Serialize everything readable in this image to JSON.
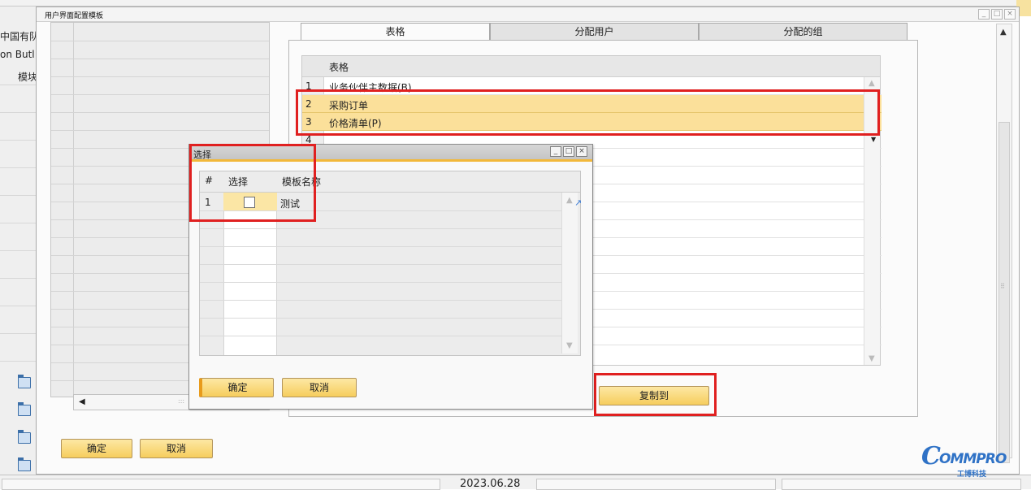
{
  "background": {
    "left_text_1": "中国有队",
    "left_text_2": "on Butl",
    "left_text_3": "模块",
    "status_date": "2023.06.28"
  },
  "window": {
    "title": "用户界面配置模板",
    "minimize": "_",
    "maximize": "□",
    "close": "×"
  },
  "tabs": [
    {
      "label": "表格",
      "active": true
    },
    {
      "label": "分配用户",
      "active": false
    },
    {
      "label": "分配的组",
      "active": false
    }
  ],
  "forms_table": {
    "header": "表格",
    "rows": [
      {
        "num": "1",
        "name": "业务伙伴主数据(B)"
      },
      {
        "num": "2",
        "name": "采购订单"
      },
      {
        "num": "3",
        "name": "价格清单(P)"
      },
      {
        "num": "4",
        "name": ""
      }
    ]
  },
  "copy_to_button": "复制到",
  "bottom_buttons": {
    "ok": "确定",
    "cancel": "取消"
  },
  "popup": {
    "title": "选择",
    "columns": {
      "num": "#",
      "select": "选择",
      "template_name": "模板名称"
    },
    "rows": [
      {
        "num": "1",
        "checked": false,
        "name": "测试"
      }
    ],
    "ok": "确定",
    "cancel": "取消"
  },
  "logo": {
    "brand": "OMMPRO",
    "brand_initial": "C",
    "sub": "工博科技"
  },
  "colors": {
    "selected_row": "#fbe09a",
    "button": "#f6cd5d",
    "highlight_border": "#e02020",
    "popup_title_accent": "#f2b83a",
    "logo": "#2f72c6"
  }
}
